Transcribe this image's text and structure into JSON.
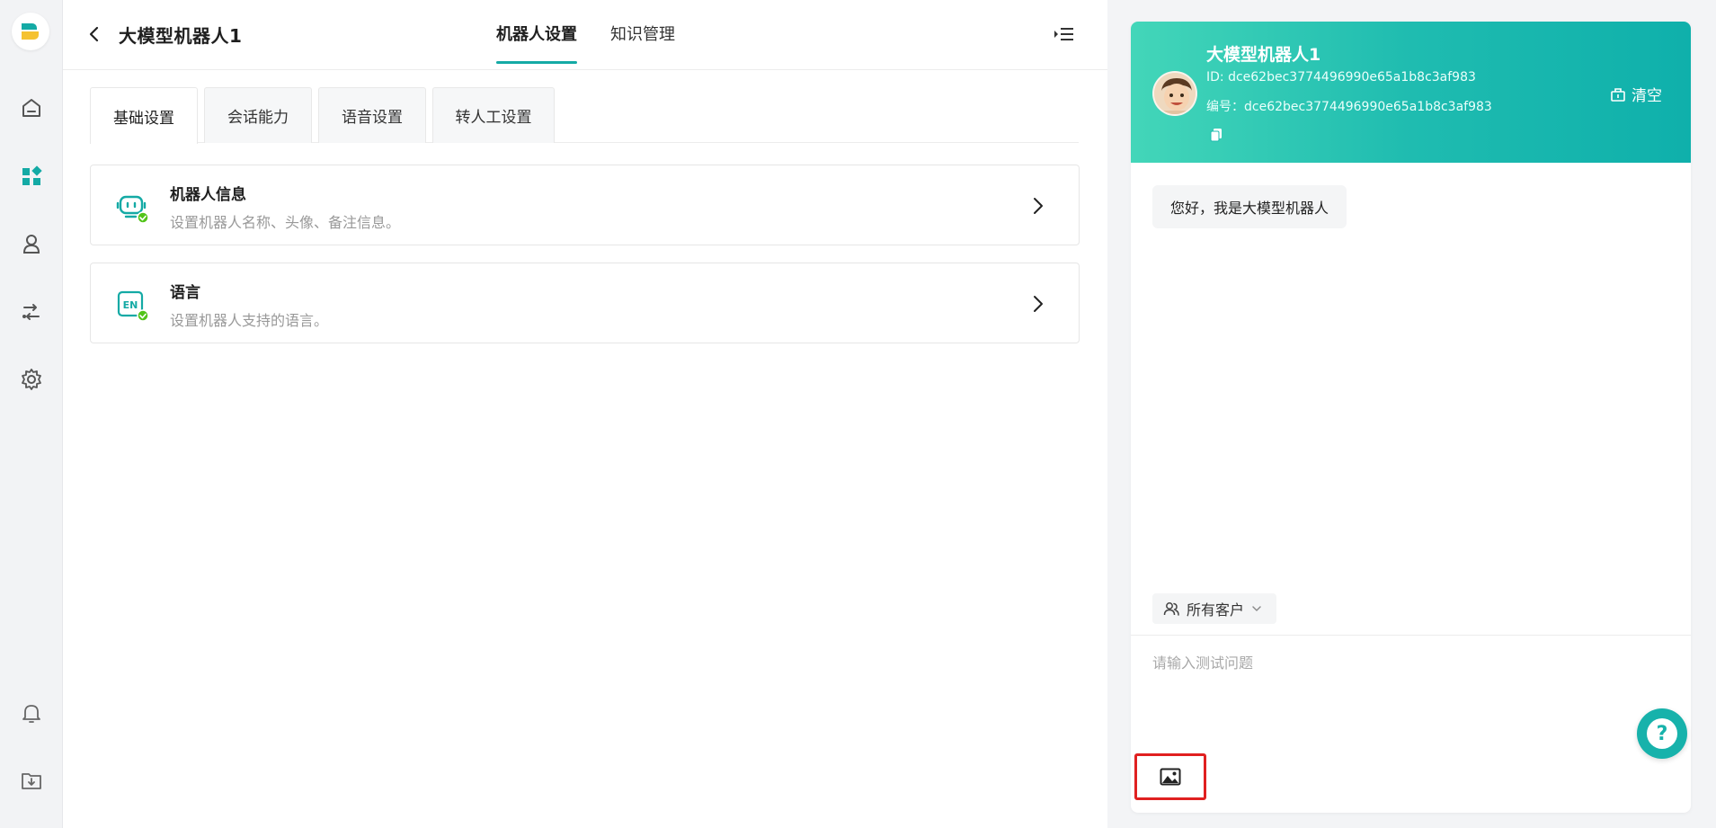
{
  "header": {
    "title": "大模型机器人1",
    "tabs": [
      {
        "label": "机器人设置",
        "active": true
      },
      {
        "label": "知识管理",
        "active": false
      }
    ]
  },
  "subtabs": [
    {
      "label": "基础设置",
      "active": true
    },
    {
      "label": "会话能力",
      "active": false
    },
    {
      "label": "语音设置",
      "active": false
    },
    {
      "label": "转人工设置",
      "active": false
    }
  ],
  "cards": [
    {
      "title": "机器人信息",
      "desc": "设置机器人名称、头像、备注信息。",
      "icon": "robot-icon"
    },
    {
      "title": "语言",
      "desc": "设置机器人支持的语言。",
      "icon": "language-en-icon"
    }
  ],
  "sidebar": {
    "items": [
      {
        "icon": "home-icon"
      },
      {
        "icon": "apps-icon",
        "active": true
      },
      {
        "icon": "user-icon"
      },
      {
        "icon": "flow-icon"
      },
      {
        "icon": "gear-icon"
      },
      {
        "icon": "bell-icon"
      },
      {
        "icon": "download-folder-icon"
      }
    ]
  },
  "chat": {
    "bot_name": "大模型机器人1",
    "bot_id": "ID: dce62bec3774496990e65a1b8c3af983",
    "bot_code": "编号：dce62bec3774496990e65a1b8c3af983",
    "clear_label": "清空",
    "greeting": "您好，我是大模型机器人",
    "scope_label": "所有客户",
    "input_placeholder": "请输入测试问题",
    "help_label": "?"
  },
  "colors": {
    "accent": "#14aaa5",
    "header_gradient_start": "#43d6b9",
    "header_gradient_end": "#0fb0ab",
    "highlight_border": "#e02020",
    "success": "#52c41a"
  }
}
